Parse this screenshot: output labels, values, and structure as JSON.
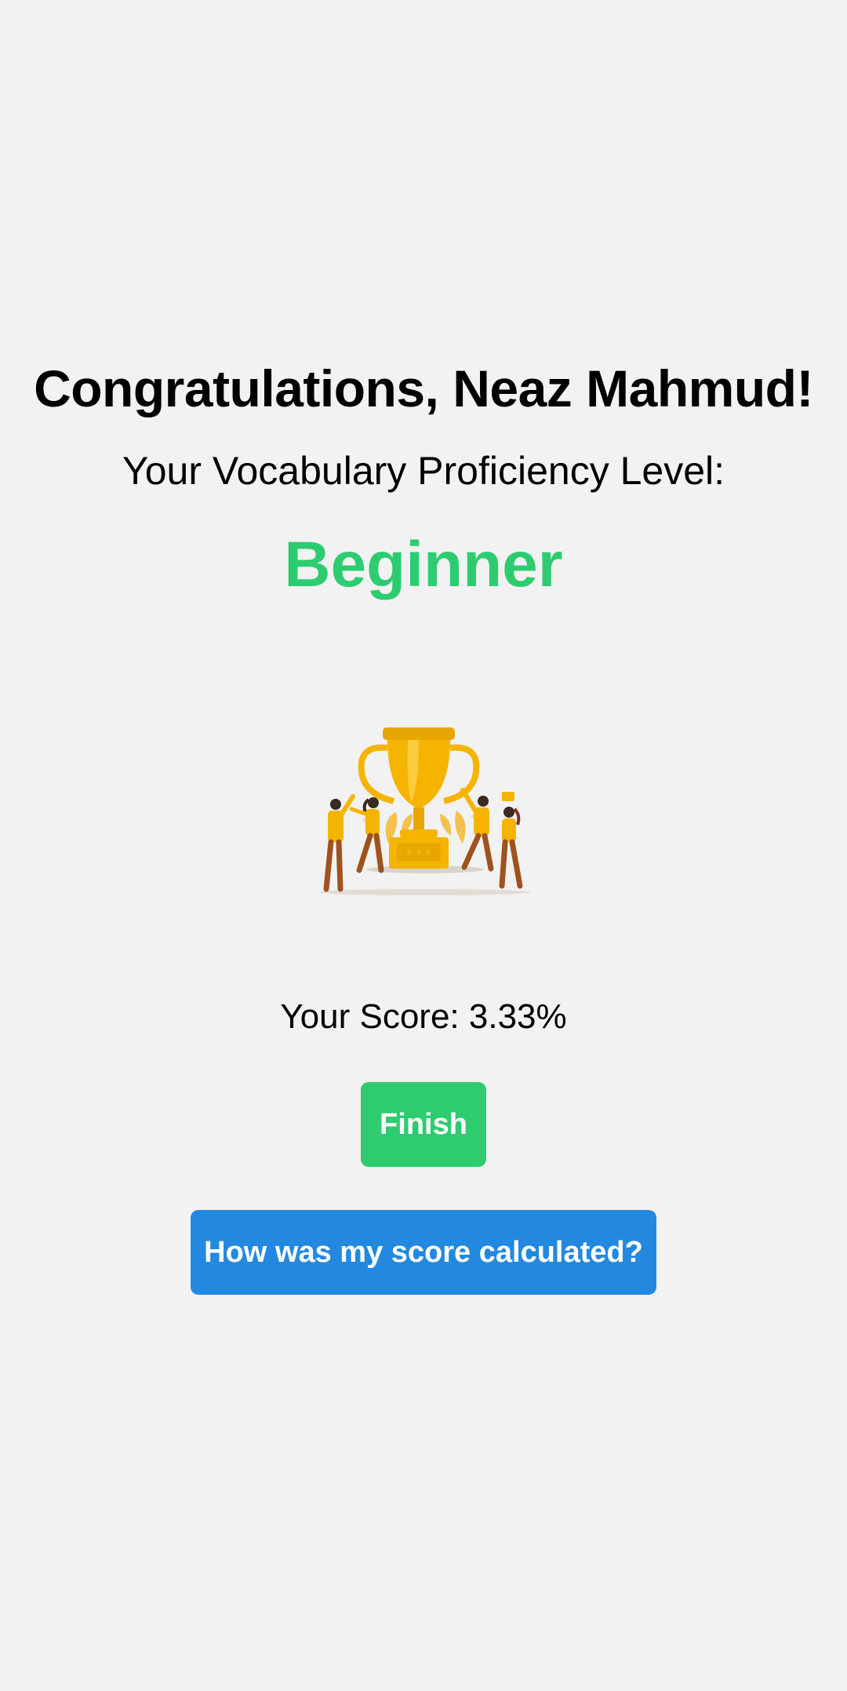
{
  "result": {
    "congrats_text": "Congratulations, Neaz Mahmud!",
    "proficiency_label": "Your Vocabulary Proficiency Level:",
    "level": "Beginner",
    "score_text": "Your Score: 3.33%"
  },
  "illustration": {
    "icon": "trophy-celebration-illustration"
  },
  "actions": {
    "finish_label": "Finish",
    "calc_label": "How was my score calculated?"
  },
  "colors": {
    "background": "#f2f2f2",
    "level_green": "#2ecc71",
    "finish_button": "#2ecc71",
    "calc_button": "#2389e0",
    "trophy_gold": "#f5b400"
  }
}
